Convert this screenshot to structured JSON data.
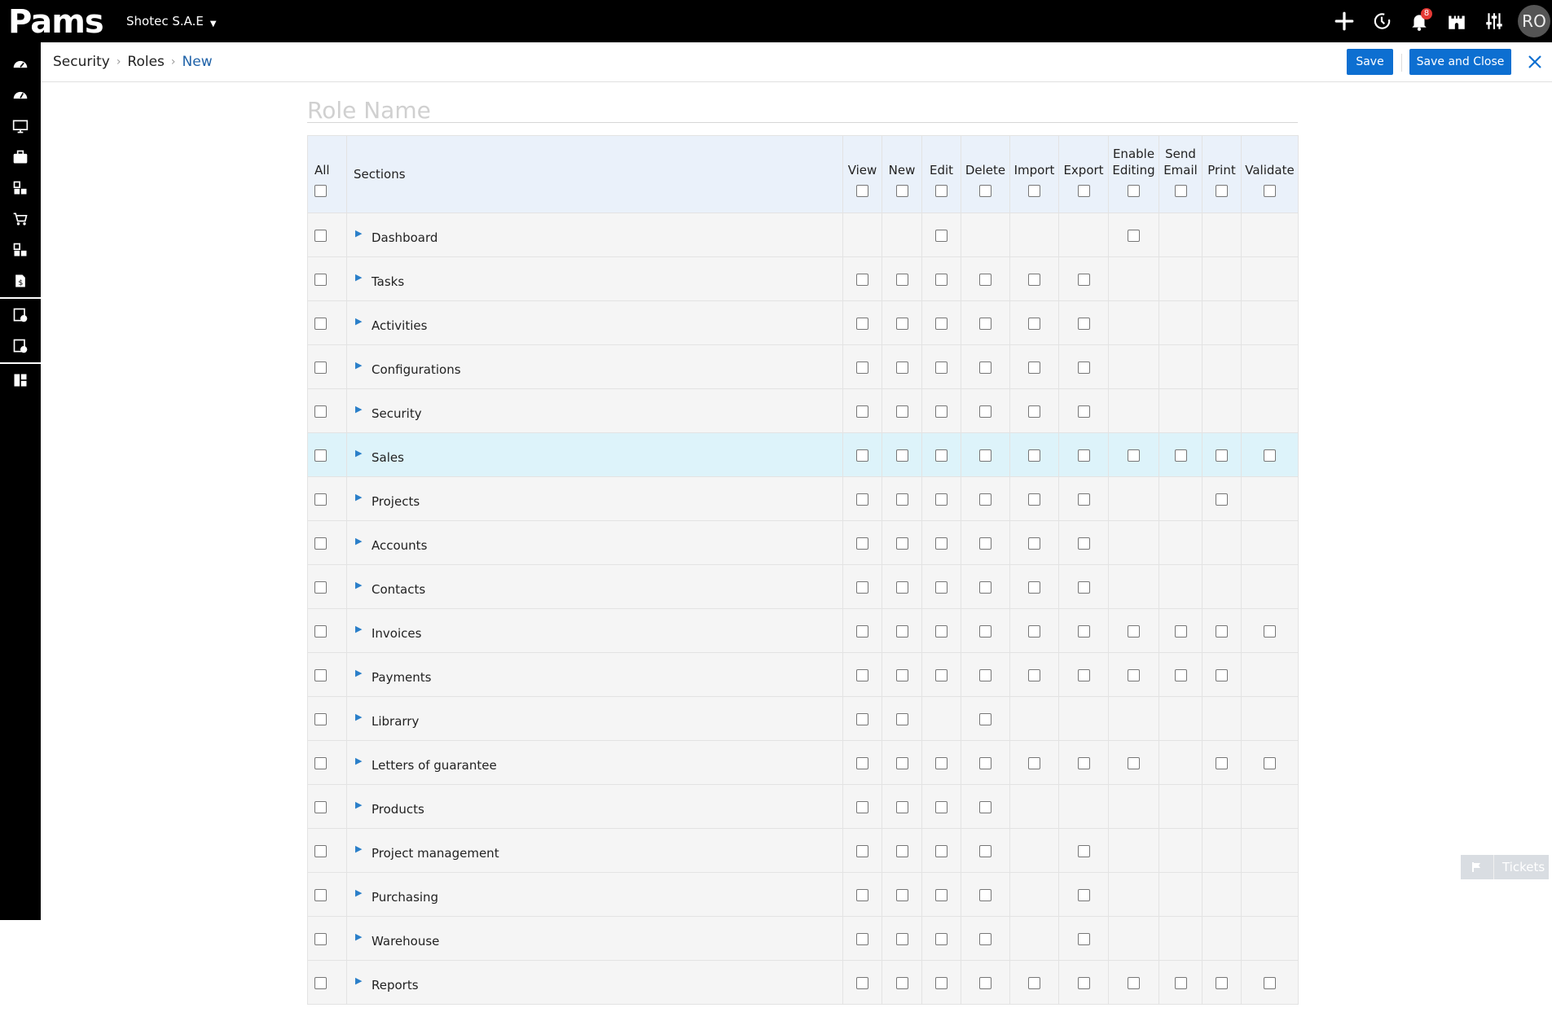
{
  "app": {
    "logo_text": "Pams",
    "company": "Shotec S.A.E",
    "notifications_count": "8",
    "avatar_initials": "RO"
  },
  "breadcrumb": [
    "Security",
    "Roles",
    "New"
  ],
  "buttons": {
    "save": "Save",
    "save_close": "Save and Close"
  },
  "form": {
    "role_name_placeholder": "Role Name",
    "role_name_value": ""
  },
  "table": {
    "all_label": "All",
    "sections_label": "Sections",
    "columns": [
      "View",
      "New",
      "Edit",
      "Delete",
      "Import",
      "Export",
      "Enable\nEditing",
      "Send\nEmail",
      "Print",
      "Validate"
    ],
    "rows": [
      {
        "name": "Dashboard",
        "perms": [
          0,
          0,
          1,
          0,
          0,
          0,
          1,
          0,
          0,
          0
        ],
        "highlight": false
      },
      {
        "name": "Tasks",
        "perms": [
          1,
          1,
          1,
          1,
          1,
          1,
          0,
          0,
          0,
          0
        ],
        "highlight": false
      },
      {
        "name": "Activities",
        "perms": [
          1,
          1,
          1,
          1,
          1,
          1,
          0,
          0,
          0,
          0
        ],
        "highlight": false
      },
      {
        "name": "Configurations",
        "perms": [
          1,
          1,
          1,
          1,
          1,
          1,
          0,
          0,
          0,
          0
        ],
        "highlight": false
      },
      {
        "name": "Security",
        "perms": [
          1,
          1,
          1,
          1,
          1,
          1,
          0,
          0,
          0,
          0
        ],
        "highlight": false
      },
      {
        "name": "Sales",
        "perms": [
          1,
          1,
          1,
          1,
          1,
          1,
          1,
          1,
          1,
          1
        ],
        "highlight": true
      },
      {
        "name": "Projects",
        "perms": [
          1,
          1,
          1,
          1,
          1,
          1,
          0,
          0,
          1,
          0
        ],
        "highlight": false
      },
      {
        "name": "Accounts",
        "perms": [
          1,
          1,
          1,
          1,
          1,
          1,
          0,
          0,
          0,
          0
        ],
        "highlight": false
      },
      {
        "name": "Contacts",
        "perms": [
          1,
          1,
          1,
          1,
          1,
          1,
          0,
          0,
          0,
          0
        ],
        "highlight": false
      },
      {
        "name": "Invoices",
        "perms": [
          1,
          1,
          1,
          1,
          1,
          1,
          1,
          1,
          1,
          1
        ],
        "highlight": false
      },
      {
        "name": "Payments",
        "perms": [
          1,
          1,
          1,
          1,
          1,
          1,
          1,
          1,
          1,
          0
        ],
        "highlight": false
      },
      {
        "name": "Librarry",
        "perms": [
          1,
          1,
          0,
          1,
          0,
          0,
          0,
          0,
          0,
          0
        ],
        "highlight": false
      },
      {
        "name": "Letters of guarantee",
        "perms": [
          1,
          1,
          1,
          1,
          1,
          1,
          1,
          0,
          1,
          1
        ],
        "highlight": false
      },
      {
        "name": "Products",
        "perms": [
          1,
          1,
          1,
          1,
          0,
          0,
          0,
          0,
          0,
          0
        ],
        "highlight": false
      },
      {
        "name": "Project management",
        "perms": [
          1,
          1,
          1,
          1,
          0,
          1,
          0,
          0,
          0,
          0
        ],
        "highlight": false
      },
      {
        "name": "Purchasing",
        "perms": [
          1,
          1,
          1,
          1,
          0,
          1,
          0,
          0,
          0,
          0
        ],
        "highlight": false
      },
      {
        "name": "Warehouse",
        "perms": [
          1,
          1,
          1,
          1,
          0,
          1,
          0,
          0,
          0,
          0
        ],
        "highlight": false
      },
      {
        "name": "Reports",
        "perms": [
          1,
          1,
          1,
          1,
          1,
          1,
          1,
          1,
          1,
          1
        ],
        "highlight": false
      }
    ]
  },
  "tickets": {
    "label": "Tickets"
  },
  "sidebar_icons": [
    "dashboard-icon",
    "dashboard-alt-icon",
    "monitor-icon",
    "briefcase-icon",
    "modules-icon",
    "cart-icon",
    "modules-alt-icon",
    "invoice-dollar-icon",
    "document-check-icon",
    "document-settings-icon",
    "grid-layout-icon"
  ]
}
